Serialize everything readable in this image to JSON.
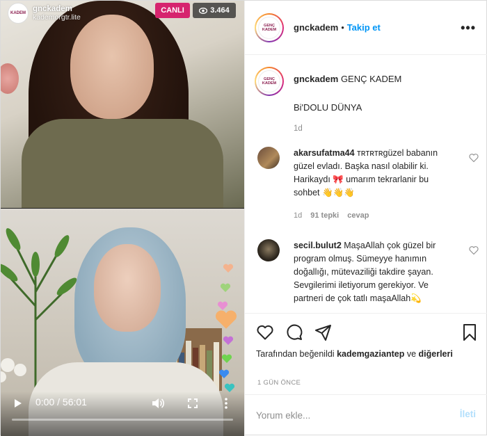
{
  "video": {
    "account_name": "gnckadem",
    "account_sub": "kademorgtr.lite",
    "live_label": "CANLI",
    "viewer_count": "3.464",
    "time_display": "0:00 / 56:01",
    "progress_fraction": 0.0
  },
  "post": {
    "username": "gnckadem",
    "separator": "•",
    "follow_label": "Takip et",
    "more_label": "•••",
    "avatar_logo_top": "GENÇ",
    "avatar_logo_bottom": "KADEM",
    "caption_user": "gnckadem",
    "caption_text": "GENÇ KADEM",
    "caption_body": "Bi'DOLU DÜNYA",
    "caption_age": "1d"
  },
  "comments": [
    {
      "user": "akarsufatma44",
      "text": "ᴛʀᴛʀᴛʀgüzel babanın güzel evladı. Başka nasıl olabilir ki. Harikaydı 🎀 umarım tekrarlanir bu sohbet 👋👋👋",
      "age": "1d",
      "likes": "91 tepki",
      "reply": "cevap"
    },
    {
      "user": "secil.bulut2",
      "text": "MaşaAllah çok güzel bir program olmuş. Sümeyye hanımın doğallığı, mütevaziliği takdire şayan. Sevgilerimi iletiyorum gerekiyor. Ve partneri de çok tatlı maşaAllah💫",
      "age": "",
      "likes": "",
      "reply": ""
    }
  ],
  "likes": {
    "prefix": "Tarafından beğenildi",
    "user": "kademgaziantep",
    "middle": "ve",
    "others": "diğerleri"
  },
  "time_ago": "1 GÜN ÖNCE",
  "add_comment": {
    "placeholder": "Yorum ekle...",
    "post_label": "İleti"
  },
  "colors": {
    "accent_blue": "#0095f6",
    "live_pink": "#d6246e",
    "muted": "#8e8e8e"
  }
}
